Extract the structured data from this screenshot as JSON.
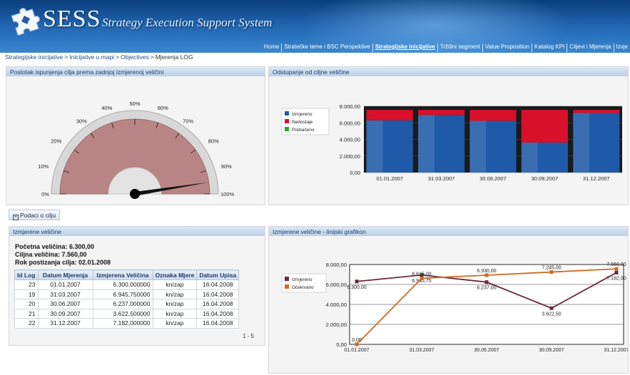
{
  "app": {
    "acronym": "SESS",
    "full_title": "Strategy Execution Support System"
  },
  "nav": [
    {
      "label": "Home",
      "active": false
    },
    {
      "label": "Stratečke teme i BSC Perspektive",
      "active": false
    },
    {
      "label": "Strategijske inicijative",
      "active": true
    },
    {
      "label": "Tržišni segment",
      "active": false
    },
    {
      "label": "Value Proposition",
      "active": false
    },
    {
      "label": "Katalog KPI",
      "active": false
    },
    {
      "label": "Ciljevi i Mjerenja",
      "active": false
    },
    {
      "label": "Izvje",
      "active": false
    }
  ],
  "breadcrumb": [
    "Strategijske inicijative",
    "Inicijative u mapi",
    "Objectives",
    "Mjerenja LOG"
  ],
  "breadcrumb_sep": ">",
  "panels": {
    "gauge_title": "Postotak ispunjenja cilja prema zadnjoj izmjerenoj veličini",
    "bar_title": "Odstupanje od ciljne veličine",
    "table_title": "Izmjerene veličine",
    "line_title": "Izmjerene veličine - linijski grafikon"
  },
  "tab_button": {
    "label": "Podaci o cilju",
    "icon": "plus-box-icon"
  },
  "info": {
    "start": "Početna veličina: 6.300,00",
    "target": "Ciljna veličina: 7.560,00",
    "deadline": "Rok postizanja cilja: 02.01.2008"
  },
  "table": {
    "headers": [
      "Id Log",
      "Datum Mjerenja",
      "Izmjerena Veličina",
      "Oznaka Mjere",
      "Datum Upisa"
    ],
    "rows": [
      [
        "23",
        "01.01.2007",
        "6.300,000000",
        "kn/zap",
        "16.04.2008"
      ],
      [
        "19",
        "31.03.2007",
        "6.945,750000",
        "kn/zap",
        "16.04.2008"
      ],
      [
        "20",
        "30.06.2007",
        "6.237,000000",
        "kn/zap",
        "16.04.2008"
      ],
      [
        "21",
        "30.09.2007",
        "3.622,500000",
        "kn/zap",
        "16.04.2008"
      ],
      [
        "22",
        "31.12.2007",
        "7.182,000000",
        "kn/zap",
        "16.04.2008"
      ]
    ],
    "pager": "1 - 5"
  },
  "colors": {
    "gauge_fill": "#b98584",
    "gauge_rim": "#d8d8d8",
    "needle": "#111111",
    "bar_measured": "#1e5aa8",
    "bar_missing": "#d8102a",
    "bar_exceeded": "#22aa22",
    "line_measured": "#6b2a3a",
    "line_expected": "#d2691e"
  },
  "chart_data": [
    {
      "type": "gauge",
      "tick_labels": [
        "0%",
        "10%",
        "20%",
        "30%",
        "40%",
        "50%",
        "60%",
        "70%",
        "80%",
        "90%",
        "100%"
      ],
      "range": [
        0,
        100
      ],
      "value": 95
    },
    {
      "type": "bar",
      "stacked": true,
      "categories": [
        "01.01.2007",
        "31.03.2007",
        "30.06.2007",
        "30.09.2007",
        "31.12.2007"
      ],
      "series": [
        {
          "name": "Izmjereno",
          "values": [
            6300,
            6945.75,
            6237,
            3622.5,
            7182
          ]
        },
        {
          "name": "Nedostaje",
          "values": [
            1260,
            614.25,
            1323,
            3937.5,
            378
          ]
        },
        {
          "name": "Prebačeno",
          "values": [
            0,
            0,
            0,
            0,
            0
          ]
        }
      ],
      "ylim": [
        0,
        8000
      ],
      "yticks": [
        "0,00",
        "2.000,00",
        "4.000,00",
        "6.000,00",
        "8.000,00"
      ],
      "legend": "left"
    },
    {
      "type": "line",
      "categories": [
        "01.01.2007",
        "31.03.2007",
        "30.06.2007",
        "30.09.2007",
        "31.12.2007"
      ],
      "series": [
        {
          "name": "Izmjereno",
          "values": [
            6300,
            6945.75,
            6237,
            3622.5,
            7182
          ],
          "labels": [
            "6.300,00",
            "6.945,75",
            "6.237,00",
            "3.622,50",
            "7.182,00"
          ]
        },
        {
          "name": "Očekivano",
          "values": [
            0,
            6615,
            6930,
            7245,
            7560
          ],
          "labels": [
            "0,00",
            "6.615,00",
            "6.930,00",
            "7.245,00",
            "7.560,00"
          ]
        }
      ],
      "ylim": [
        0,
        8000
      ],
      "yticks": [
        "0,00",
        "2.000,00",
        "4.000,00",
        "6.000,00",
        "8.000,00"
      ],
      "legend": "left"
    }
  ]
}
